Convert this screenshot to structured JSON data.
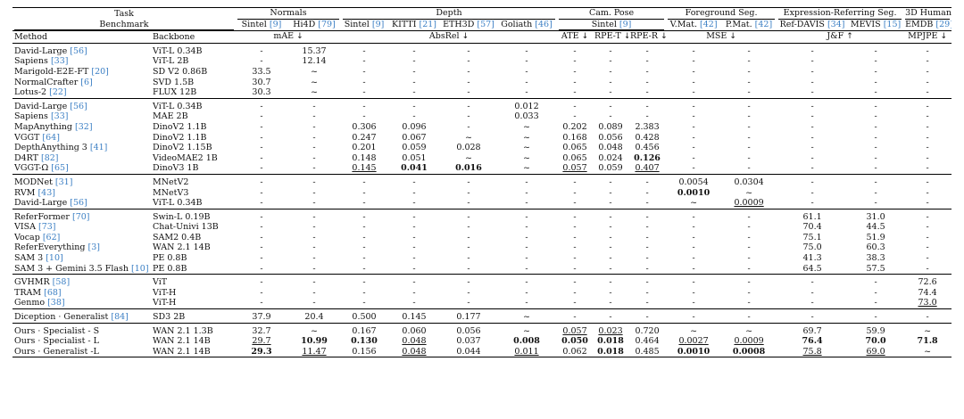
{
  "header": {
    "row1": {
      "task": "Task",
      "normals": "Normals",
      "depth": "Depth",
      "cam_pose": "Cam. Pose",
      "fg_seg": "Foreground Seg.",
      "ref_seg": "Expression-Referring Seg.",
      "human3d": "3D Human"
    },
    "row2": {
      "benchmark": "Benchmark",
      "n_sintel": "Sintel",
      "n_sintel_cite": "[9]",
      "n_hi4d": "Hi4D",
      "n_hi4d_cite": "[79]",
      "d_sintel": "Sintel",
      "d_sintel_cite": "[9]",
      "d_kitti": "KITTI",
      "d_kitti_cite": "[21]",
      "d_eth3d": "ETH3D",
      "d_eth3d_cite": "[57]",
      "d_goliath": "Goliath",
      "d_goliath_cite": "[46]",
      "p_sintel": "Sintel",
      "p_sintel_cite": "[9]",
      "f_vmat": "V.Mat.",
      "f_vmat_cite": "[42]",
      "f_pmat": "P.Mat.",
      "f_pmat_cite": "[42]",
      "r_davis": "Ref-DAVIS",
      "r_davis_cite": "[34]",
      "r_mevis": "MEVIS",
      "r_mevis_cite": "[15]",
      "h_emdb": "EMDB",
      "h_emdb_cite": "[29]"
    },
    "row3": {
      "method": "Method",
      "backbone": "Backbone",
      "mae": "mAE",
      "absrel": "AbsRel",
      "ate": "ATE",
      "rpet": "RPE-T",
      "rper": "RPE-R",
      "mse": "MSE",
      "jf": "J&F",
      "mpjpe": "MPJPE",
      "down": "↓",
      "up": "↑"
    }
  },
  "groups": [
    {
      "rows": [
        {
          "name": "David-Large",
          "cite": "[56]",
          "backbone": "ViT-L 0.34B",
          "cells": [
            "-",
            "15.37",
            "-",
            "-",
            "-",
            "-",
            "-",
            "-",
            "-",
            "-",
            "-",
            "-",
            "-",
            "-"
          ]
        },
        {
          "name": "Sapiens",
          "cite": "[33]",
          "backbone": "ViT-L 2B",
          "cells": [
            "-",
            "12.14",
            "-",
            "-",
            "-",
            "-",
            "-",
            "-",
            "-",
            "-",
            "-",
            "-",
            "-",
            "-"
          ]
        },
        {
          "name": "Marigold-E2E-FT",
          "cite": "[20]",
          "backbone": "SD V2 0.86B",
          "cells": [
            "33.5",
            "~",
            "-",
            "-",
            "-",
            "-",
            "-",
            "-",
            "-",
            "-",
            "-",
            "-",
            "-",
            "-"
          ]
        },
        {
          "name": "NormalCrafter",
          "cite": "[6]",
          "backbone": "SVD 1.5B",
          "cells": [
            "30.7",
            "~",
            "-",
            "-",
            "-",
            "-",
            "-",
            "-",
            "-",
            "-",
            "-",
            "-",
            "-",
            "-"
          ]
        },
        {
          "name": "Lotus-2",
          "cite": "[22]",
          "backbone": "FLUX 12B",
          "cells": [
            "30.3",
            "~",
            "-",
            "-",
            "-",
            "-",
            "-",
            "-",
            "-",
            "-",
            "-",
            "-",
            "-",
            "-"
          ]
        }
      ]
    },
    {
      "rows": [
        {
          "name": "David-Large",
          "cite": "[56]",
          "backbone": "ViT-L 0.34B",
          "cells": [
            "-",
            "-",
            "-",
            "-",
            "-",
            "0.012",
            "-",
            "-",
            "-",
            "-",
            "-",
            "-",
            "-",
            "-"
          ]
        },
        {
          "name": "Sapiens",
          "cite": "[33]",
          "backbone": "MAE 2B",
          "cells": [
            "-",
            "-",
            "-",
            "-",
            "-",
            "0.033",
            "-",
            "-",
            "-",
            "-",
            "-",
            "-",
            "-",
            "-"
          ]
        },
        {
          "name": "MapAnything",
          "cite": "[32]",
          "backbone": "DinoV2 1.1B",
          "cells": [
            "-",
            "-",
            "0.306",
            "0.096",
            "-",
            "~",
            "0.202",
            "0.089",
            "2.383",
            "-",
            "-",
            "-",
            "-",
            "-"
          ]
        },
        {
          "name": "VGGT",
          "cite": "[64]",
          "backbone": "DinoV2 1.1B",
          "cells": [
            "-",
            "-",
            "0.247",
            "0.067",
            "~",
            "~",
            "0.168",
            "0.056",
            "0.428",
            "-",
            "-",
            "-",
            "-",
            "-"
          ]
        },
        {
          "name": "DepthAnything 3",
          "cite": "[41]",
          "backbone": "DinoV2 1.15B",
          "cells": [
            "-",
            "-",
            "0.201",
            "0.059",
            "0.028",
            "~",
            "0.065",
            "0.048",
            "0.456",
            "-",
            "-",
            "-",
            "-",
            "-"
          ]
        },
        {
          "name": "D4RT",
          "cite": "[82]",
          "backbone": "VideoMAE2 1B",
          "cells": [
            "-",
            "-",
            "0.148",
            "0.051",
            "~",
            "~",
            "0.065",
            "0.024",
            "0.126",
            "-",
            "-",
            "-",
            "-",
            "-"
          ],
          "bold": [
            8
          ]
        },
        {
          "name": "VGGT-Ω",
          "cite": "[65]",
          "backbone": "DinoV3 1B",
          "cells": [
            "-",
            "-",
            "0.145",
            "0.041",
            "0.016",
            "~",
            "0.057",
            "0.059",
            "0.407",
            "-",
            "-",
            "-",
            "-",
            "-"
          ],
          "bold": [
            3,
            4
          ],
          "underline": [
            2,
            6,
            8
          ]
        }
      ]
    },
    {
      "rows": [
        {
          "name": "MODNet",
          "cite": "[31]",
          "backbone": "MNetV2",
          "cells": [
            "-",
            "-",
            "-",
            "-",
            "-",
            "-",
            "-",
            "-",
            "-",
            "0.0054",
            "0.0304",
            "-",
            "-",
            "-"
          ]
        },
        {
          "name": "RVM",
          "cite": "[43]",
          "backbone": "MNetV3",
          "cells": [
            "-",
            "-",
            "-",
            "-",
            "-",
            "-",
            "-",
            "-",
            "-",
            "0.0010",
            "~",
            "-",
            "-",
            "-"
          ],
          "bold": [
            9
          ]
        },
        {
          "name": "David-Large",
          "cite": "[56]",
          "backbone": "ViT-L 0.34B",
          "cells": [
            "-",
            "-",
            "-",
            "-",
            "-",
            "-",
            "-",
            "-",
            "-",
            "~",
            "0.0009",
            "-",
            "-",
            "-"
          ],
          "underline": [
            10
          ]
        }
      ]
    },
    {
      "rows": [
        {
          "name": "ReferFormer",
          "cite": "[70]",
          "backbone": "Swin-L 0.19B",
          "cells": [
            "-",
            "-",
            "-",
            "-",
            "-",
            "-",
            "-",
            "-",
            "-",
            "-",
            "-",
            "61.1",
            "31.0",
            "-"
          ]
        },
        {
          "name": "VISA",
          "cite": "[73]",
          "backbone": "Chat-Univi 13B",
          "cells": [
            "-",
            "-",
            "-",
            "-",
            "-",
            "-",
            "-",
            "-",
            "-",
            "-",
            "-",
            "70.4",
            "44.5",
            "-"
          ]
        },
        {
          "name": "Vocap",
          "cite": "[62]",
          "backbone": "SAM2 0.4B",
          "cells": [
            "-",
            "-",
            "-",
            "-",
            "-",
            "-",
            "-",
            "-",
            "-",
            "-",
            "-",
            "75.1",
            "51.9",
            "-"
          ]
        },
        {
          "name": "ReferEverything",
          "cite": "[3]",
          "backbone": "WAN 2.1 14B",
          "cells": [
            "-",
            "-",
            "-",
            "-",
            "-",
            "-",
            "-",
            "-",
            "-",
            "-",
            "-",
            "75.0",
            "60.3",
            "-"
          ]
        },
        {
          "name": "SAM 3",
          "cite": "[10]",
          "backbone": "PE 0.8B",
          "cells": [
            "-",
            "-",
            "-",
            "-",
            "-",
            "-",
            "-",
            "-",
            "-",
            "-",
            "-",
            "41.3",
            "38.3",
            "-"
          ]
        },
        {
          "name": "SAM 3 + Gemini 3.5 Flash",
          "cite": "[10]",
          "backbone": "PE 0.8B",
          "cells": [
            "-",
            "-",
            "-",
            "-",
            "-",
            "-",
            "-",
            "-",
            "-",
            "-",
            "-",
            "64.5",
            "57.5",
            "-"
          ]
        }
      ]
    },
    {
      "rows": [
        {
          "name": "GVHMR",
          "cite": "[58]",
          "backbone": "ViT",
          "cells": [
            "-",
            "-",
            "-",
            "-",
            "-",
            "-",
            "-",
            "-",
            "-",
            "-",
            "-",
            "-",
            "-",
            "72.6"
          ]
        },
        {
          "name": "TRAM",
          "cite": "[68]",
          "backbone": "ViT-H",
          "cells": [
            "-",
            "-",
            "-",
            "-",
            "-",
            "-",
            "-",
            "-",
            "-",
            "-",
            "-",
            "-",
            "-",
            "74.4"
          ]
        },
        {
          "name": "Genmo",
          "cite": "[38]",
          "backbone": "ViT-H",
          "cells": [
            "-",
            "-",
            "-",
            "-",
            "-",
            "-",
            "-",
            "-",
            "-",
            "-",
            "-",
            "-",
            "-",
            "73.0"
          ],
          "underline": [
            13
          ]
        }
      ]
    },
    {
      "rows": [
        {
          "name": "Diception · Generalist",
          "cite": "[84]",
          "backbone": "SD3 2B",
          "cells": [
            "37.9",
            "20.4",
            "0.500",
            "0.145",
            "0.177",
            "~",
            "-",
            "-",
            "-",
            "-",
            "-",
            "-",
            "-",
            "-"
          ]
        }
      ]
    },
    {
      "rows": [
        {
          "name": "Ours · Specialist - S",
          "cite": "",
          "backbone": "WAN 2.1 1.3B",
          "cells": [
            "32.7",
            "~",
            "0.167",
            "0.060",
            "0.056",
            "~",
            "0.057",
            "0.023",
            "0.720",
            "~",
            "~",
            "69.7",
            "59.9",
            "~"
          ],
          "underline": [
            6,
            7
          ]
        },
        {
          "name": "Ours · Specialist - L",
          "cite": "",
          "backbone": "WAN 2.1 14B",
          "cells": [
            "29.7",
            "10.99",
            "0.130",
            "0.048",
            "0.037",
            "0.008",
            "0.050",
            "0.018",
            "0.464",
            "0.0027",
            "0.0009",
            "76.4",
            "70.0",
            "71.8"
          ],
          "bold": [
            1,
            2,
            5,
            6,
            7,
            11,
            12,
            13
          ],
          "underline": [
            0,
            3,
            9,
            10
          ]
        },
        {
          "name": "Ours · Generalist -L",
          "cite": "",
          "backbone": "WAN 2.1 14B",
          "cells": [
            "29.3",
            "11.47",
            "0.156",
            "0.048",
            "0.044",
            "0.011",
            "0.062",
            "0.018",
            "0.485",
            "0.0010",
            "0.0008",
            "75.8",
            "69.0",
            "~"
          ],
          "bold": [
            0,
            7,
            9,
            10
          ],
          "underline": [
            1,
            3,
            5,
            11,
            12
          ]
        }
      ]
    }
  ]
}
